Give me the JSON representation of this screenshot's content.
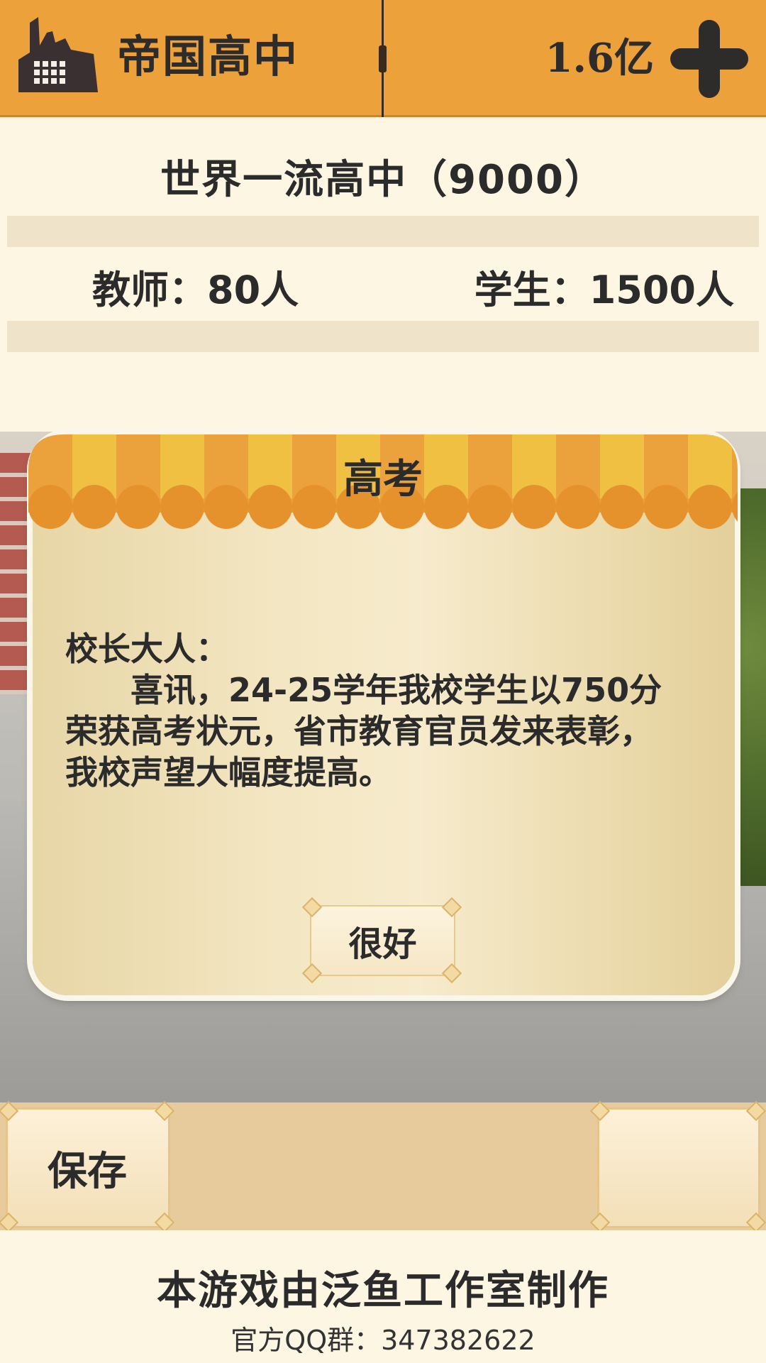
{
  "header": {
    "school_name": "帝国高中",
    "money": "1.6亿",
    "icons": {
      "school": "factory-icon",
      "add": "plus-icon"
    }
  },
  "school_info": {
    "level": "世界一流高中（9000）",
    "teachers": "教师：80人",
    "students": "学生：1500人"
  },
  "dialog": {
    "title": "高考",
    "greeting": "校长大人：",
    "message": "喜讯，24-25学年我校学生以750分荣获高考状元，省市教育官员发来表彰，我校声望大幅度提高。",
    "ok_label": "很好"
  },
  "bottom_bar": {
    "save_label": "保存",
    "right_label": ""
  },
  "footer": {
    "credit": "本游戏由泛鱼工作室制作",
    "qq_group": "官方QQ群：347382622"
  },
  "colors": {
    "accent": "#eda13b",
    "panel": "#fdf6e3",
    "dialog": "#f3e6c2",
    "text": "#2b2b2b"
  }
}
